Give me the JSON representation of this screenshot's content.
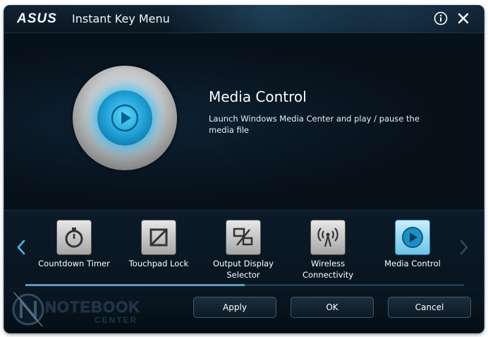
{
  "window": {
    "brand": "ASUS",
    "title": "Instant Key Menu"
  },
  "icons": {
    "info": "info-icon",
    "close": "close-icon",
    "left": "chevron-left-icon",
    "right": "chevron-right-icon"
  },
  "feature": {
    "title": "Media Control",
    "description": "Launch Windows Media Center and play / pause the media file"
  },
  "carousel": {
    "items": [
      {
        "label": "Countdown Timer",
        "icon": "stopwatch-icon",
        "selected": false
      },
      {
        "label": "Touchpad Lock",
        "icon": "touchpad-lock-icon",
        "selected": false
      },
      {
        "label": "Output Display Selector",
        "icon": "display-selector-icon",
        "selected": false
      },
      {
        "label": "Wireless Connectivity",
        "icon": "wireless-icon",
        "selected": false
      },
      {
        "label": "Media Control",
        "icon": "play-icon",
        "selected": true
      }
    ],
    "scroll_position": 0.5
  },
  "watermark": {
    "main": "NOTEBOOK",
    "sub": "CENTER"
  },
  "buttons": {
    "apply": "Apply",
    "ok": "OK",
    "cancel": "Cancel"
  },
  "colors": {
    "accent": "#2fb8ec",
    "background": "#07111a"
  }
}
